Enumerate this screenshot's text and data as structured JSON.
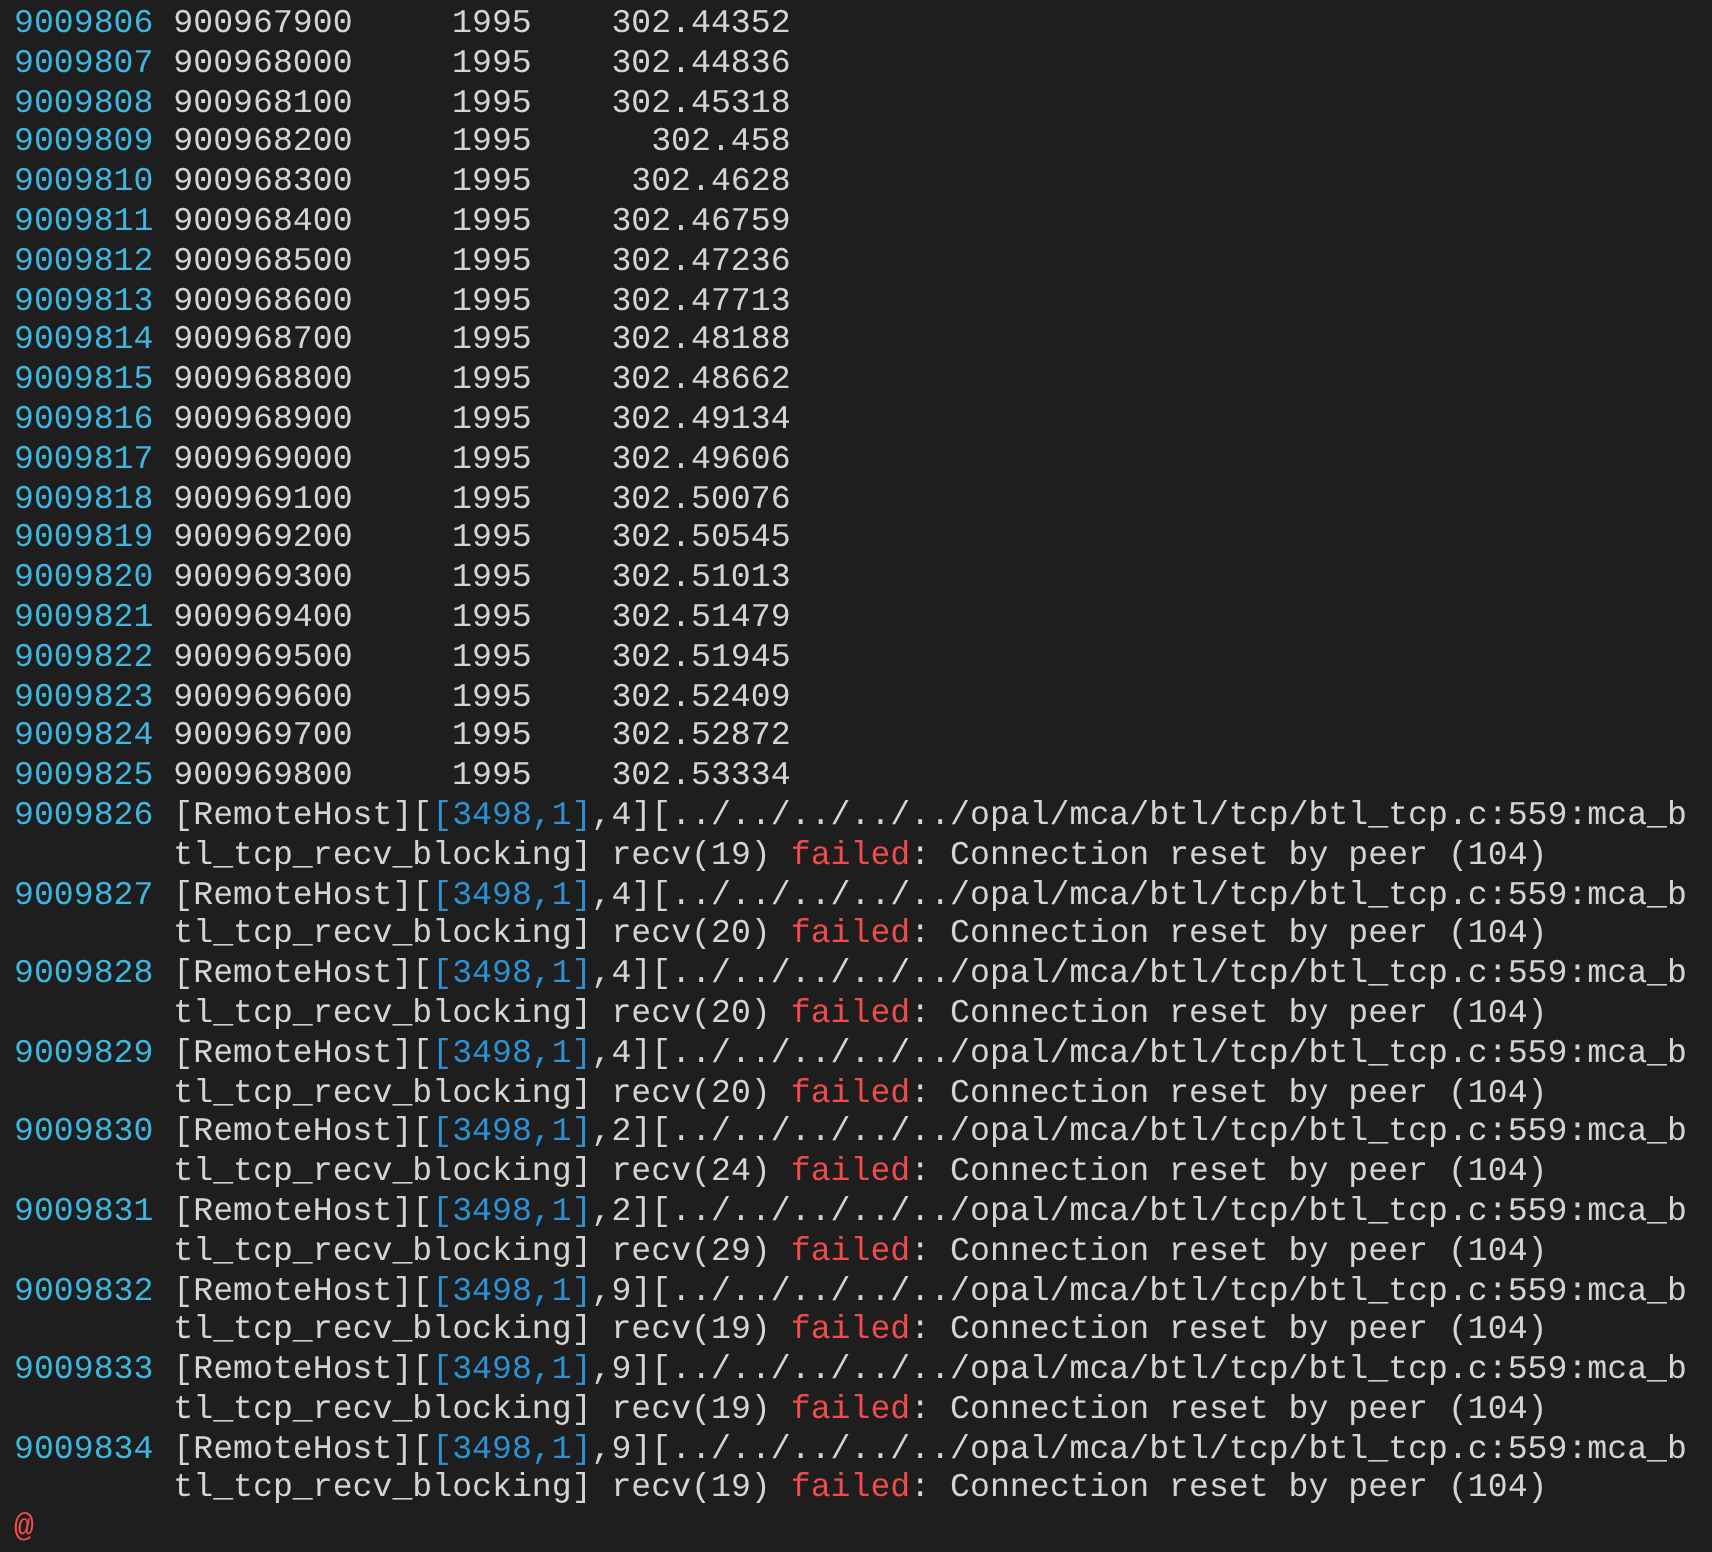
{
  "rows": [
    {
      "number": "9009806",
      "cells": [
        "900967900",
        "1995",
        "302.44352"
      ]
    },
    {
      "number": "9009807",
      "cells": [
        "900968000",
        "1995",
        "302.44836"
      ]
    },
    {
      "number": "9009808",
      "cells": [
        "900968100",
        "1995",
        "302.45318"
      ]
    },
    {
      "number": "9009809",
      "cells": [
        "900968200",
        "1995",
        "302.458"
      ]
    },
    {
      "number": "9009810",
      "cells": [
        "900968300",
        "1995",
        "302.4628"
      ]
    },
    {
      "number": "9009811",
      "cells": [
        "900968400",
        "1995",
        "302.46759"
      ]
    },
    {
      "number": "9009812",
      "cells": [
        "900968500",
        "1995",
        "302.47236"
      ]
    },
    {
      "number": "9009813",
      "cells": [
        "900968600",
        "1995",
        "302.47713"
      ]
    },
    {
      "number": "9009814",
      "cells": [
        "900968700",
        "1995",
        "302.48188"
      ]
    },
    {
      "number": "9009815",
      "cells": [
        "900968800",
        "1995",
        "302.48662"
      ]
    },
    {
      "number": "9009816",
      "cells": [
        "900968900",
        "1995",
        "302.49134"
      ]
    },
    {
      "number": "9009817",
      "cells": [
        "900969000",
        "1995",
        "302.49606"
      ]
    },
    {
      "number": "9009818",
      "cells": [
        "900969100",
        "1995",
        "302.50076"
      ]
    },
    {
      "number": "9009819",
      "cells": [
        "900969200",
        "1995",
        "302.50545"
      ]
    },
    {
      "number": "9009820",
      "cells": [
        "900969300",
        "1995",
        "302.51013"
      ]
    },
    {
      "number": "9009821",
      "cells": [
        "900969400",
        "1995",
        "302.51479"
      ]
    },
    {
      "number": "9009822",
      "cells": [
        "900969500",
        "1995",
        "302.51945"
      ]
    },
    {
      "number": "9009823",
      "cells": [
        "900969600",
        "1995",
        "302.52409"
      ]
    },
    {
      "number": "9009824",
      "cells": [
        "900969700",
        "1995",
        "302.52872"
      ]
    },
    {
      "number": "9009825",
      "cells": [
        "900969800",
        "1995",
        "302.53334"
      ]
    }
  ],
  "log": [
    {
      "number": "9009826",
      "segments": [
        {
          "kind": "plain",
          "text": "[RemoteHost]["
        },
        {
          "kind": "id",
          "text": "[3498,1]"
        },
        {
          "kind": "plain",
          "text": ",4][../../../../../opal/mca/btl/tcp/btl_tcp.c:559:mca_btl_tcp_recv_blocking] recv(19) "
        },
        {
          "kind": "error",
          "text": "failed"
        },
        {
          "kind": "plain",
          "text": ": Connection reset by peer (104)"
        }
      ]
    },
    {
      "number": "9009827",
      "segments": [
        {
          "kind": "plain",
          "text": "[RemoteHost]["
        },
        {
          "kind": "id",
          "text": "[3498,1]"
        },
        {
          "kind": "plain",
          "text": ",4][../../../../../opal/mca/btl/tcp/btl_tcp.c:559:mca_btl_tcp_recv_blocking] recv(20) "
        },
        {
          "kind": "error",
          "text": "failed"
        },
        {
          "kind": "plain",
          "text": ": Connection reset by peer (104)"
        }
      ]
    },
    {
      "number": "9009828",
      "segments": [
        {
          "kind": "plain",
          "text": "[RemoteHost]["
        },
        {
          "kind": "id",
          "text": "[3498,1]"
        },
        {
          "kind": "plain",
          "text": ",4][../../../../../opal/mca/btl/tcp/btl_tcp.c:559:mca_btl_tcp_recv_blocking] recv(20) "
        },
        {
          "kind": "error",
          "text": "failed"
        },
        {
          "kind": "plain",
          "text": ": Connection reset by peer (104)"
        }
      ]
    },
    {
      "number": "9009829",
      "segments": [
        {
          "kind": "plain",
          "text": "[RemoteHost]["
        },
        {
          "kind": "id",
          "text": "[3498,1]"
        },
        {
          "kind": "plain",
          "text": ",4][../../../../../opal/mca/btl/tcp/btl_tcp.c:559:mca_btl_tcp_recv_blocking] recv(20) "
        },
        {
          "kind": "error",
          "text": "failed"
        },
        {
          "kind": "plain",
          "text": ": Connection reset by peer (104)"
        }
      ]
    },
    {
      "number": "9009830",
      "segments": [
        {
          "kind": "plain",
          "text": "[RemoteHost]["
        },
        {
          "kind": "id",
          "text": "[3498,1]"
        },
        {
          "kind": "plain",
          "text": ",2][../../../../../opal/mca/btl/tcp/btl_tcp.c:559:mca_btl_tcp_recv_blocking] recv(24) "
        },
        {
          "kind": "error",
          "text": "failed"
        },
        {
          "kind": "plain",
          "text": ": Connection reset by peer (104)"
        }
      ]
    },
    {
      "number": "9009831",
      "segments": [
        {
          "kind": "plain",
          "text": "[RemoteHost]["
        },
        {
          "kind": "id",
          "text": "[3498,1]"
        },
        {
          "kind": "plain",
          "text": ",2][../../../../../opal/mca/btl/tcp/btl_tcp.c:559:mca_btl_tcp_recv_blocking] recv(29) "
        },
        {
          "kind": "error",
          "text": "failed"
        },
        {
          "kind": "plain",
          "text": ": Connection reset by peer (104)"
        }
      ]
    },
    {
      "number": "9009832",
      "segments": [
        {
          "kind": "plain",
          "text": "[RemoteHost]["
        },
        {
          "kind": "id",
          "text": "[3498,1]"
        },
        {
          "kind": "plain",
          "text": ",9][../../../../../opal/mca/btl/tcp/btl_tcp.c:559:mca_btl_tcp_recv_blocking] recv(19) "
        },
        {
          "kind": "error",
          "text": "failed"
        },
        {
          "kind": "plain",
          "text": ": Connection reset by peer (104)"
        }
      ]
    },
    {
      "number": "9009833",
      "segments": [
        {
          "kind": "plain",
          "text": "[RemoteHost]["
        },
        {
          "kind": "id",
          "text": "[3498,1]"
        },
        {
          "kind": "plain",
          "text": ",9][../../../../../opal/mca/btl/tcp/btl_tcp.c:559:mca_btl_tcp_recv_blocking] recv(19) "
        },
        {
          "kind": "error",
          "text": "failed"
        },
        {
          "kind": "plain",
          "text": ": Connection reset by peer (104)"
        }
      ]
    },
    {
      "number": "9009834",
      "segments": [
        {
          "kind": "plain",
          "text": "[RemoteHost]["
        },
        {
          "kind": "id",
          "text": "[3498,1]"
        },
        {
          "kind": "plain",
          "text": ",9][../../../../../opal/mca/btl/tcp/btl_tcp.c:559:mca_btl_tcp_recv_blocking] recv(19) "
        },
        {
          "kind": "error",
          "text": "failed"
        },
        {
          "kind": "plain",
          "text": ": Connection reset by peer (104)"
        }
      ]
    }
  ],
  "filler": "@"
}
